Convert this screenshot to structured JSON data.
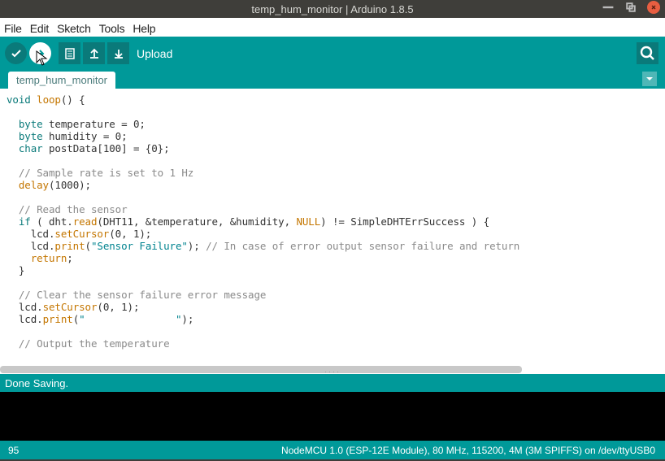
{
  "title": "temp_hum_monitor | Arduino 1.8.5",
  "menu": {
    "file": "File",
    "edit": "Edit",
    "sketch": "Sketch",
    "tools": "Tools",
    "help": "Help"
  },
  "toolbar": {
    "tooltip": "Upload"
  },
  "tab": {
    "name": "temp_hum_monitor"
  },
  "status": {
    "text": "Done Saving."
  },
  "footer": {
    "line": "95",
    "board": "NodeMCU 1.0 (ESP-12E Module), 80 MHz, 115200, 4M (3M SPIFFS) on /dev/ttyUSB0"
  },
  "code": {
    "l1a": "void",
    "l1b": " ",
    "l1c": "loop",
    "l1d": "() {",
    "l2a": "  byte",
    "l2b": " temperature = 0;",
    "l3a": "  byte",
    "l3b": " humidity = 0;",
    "l4a": "  char",
    "l4b": " postData[100] = {0};",
    "l5a": "  // Sample rate is set to 1 Hz",
    "l6a": "  ",
    "l6b": "delay",
    "l6c": "(1000);",
    "l7a": "  // Read the sensor",
    "l8a": "  if",
    "l8b": " ( dht.",
    "l8c": "read",
    "l8d": "(DHT11, &temperature, &humidity, ",
    "l8e": "NULL",
    "l8f": ") != SimpleDHTErrSuccess ) {",
    "l9a": "    lcd.",
    "l9b": "setCursor",
    "l9c": "(0, 1);",
    "l10a": "    lcd.",
    "l10b": "print",
    "l10c": "(",
    "l10d": "\"Sensor Failure\"",
    "l10e": "); ",
    "l10f": "// In case of error output sensor failure and return",
    "l11a": "    ",
    "l11b": "return",
    "l11c": ";",
    "l12a": "  }",
    "l13a": "  // Clear the sensor failure error message",
    "l14a": "  lcd.",
    "l14b": "setCursor",
    "l14c": "(0, 1);",
    "l15a": "  lcd.",
    "l15b": "print",
    "l15c": "(",
    "l15d": "\"               \"",
    "l15e": ");",
    "l16a": "  // Output the temperature"
  }
}
